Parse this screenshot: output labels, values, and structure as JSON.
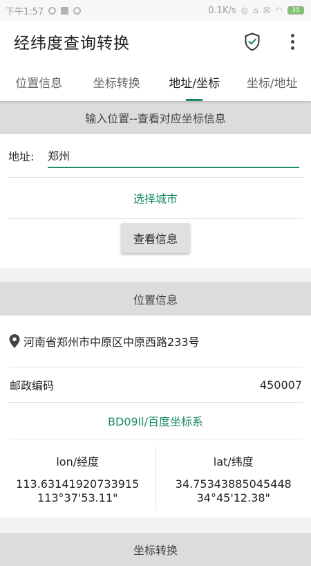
{
  "status_bar": {
    "time": "下午1:57",
    "net_speed": "0.1K/s",
    "battery": "35"
  },
  "app_bar": {
    "title": "经纬度查询转换"
  },
  "tabs": [
    {
      "label": "位置信息",
      "active": false
    },
    {
      "label": "坐标转换",
      "active": false
    },
    {
      "label": "地址/坐标",
      "active": true
    },
    {
      "label": "坐标/地址",
      "active": false
    }
  ],
  "input_section": {
    "header": "输入位置--查看对应坐标信息",
    "address_label": "地址:",
    "address_value": "郑州",
    "select_city": "选择城市",
    "query_button": "查看信息"
  },
  "location_section": {
    "header": "位置信息",
    "address": "河南省郑州市中原区中原西路233号",
    "postcode_label": "邮政编码",
    "postcode_value": "450007",
    "coord_system": "BD09ll/百度坐标系",
    "lon_label": "lon/经度",
    "lon_decimal": "113.63141920733915",
    "lon_dms": "113°37'53.11\"",
    "lat_label": "lat/纬度",
    "lat_decimal": "34.75343885045448",
    "lat_dms": "34°45'12.38\""
  },
  "next_section": {
    "header": "坐标转换"
  },
  "colors": {
    "accent": "#1c8a64",
    "section_header_bg": "#dcdcdc"
  }
}
